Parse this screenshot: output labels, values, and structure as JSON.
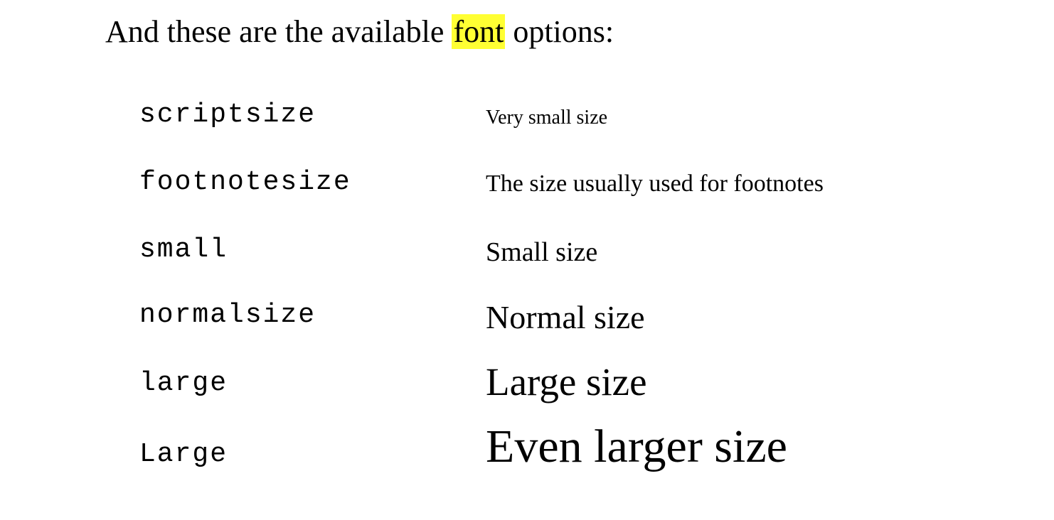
{
  "intro": {
    "before": "And these are the available ",
    "highlight": "font",
    "after": " options:"
  },
  "highlight_color": "#ffff33",
  "options": [
    {
      "command": "scriptsize",
      "description": "Very small size"
    },
    {
      "command": "footnotesize",
      "description": "The size usually used for footnotes"
    },
    {
      "command": "small",
      "description": "Small size"
    },
    {
      "command": "normalsize",
      "description": "Normal size"
    },
    {
      "command": "large",
      "description": "Large size"
    },
    {
      "command": "Large",
      "description": "Even larger size"
    }
  ]
}
